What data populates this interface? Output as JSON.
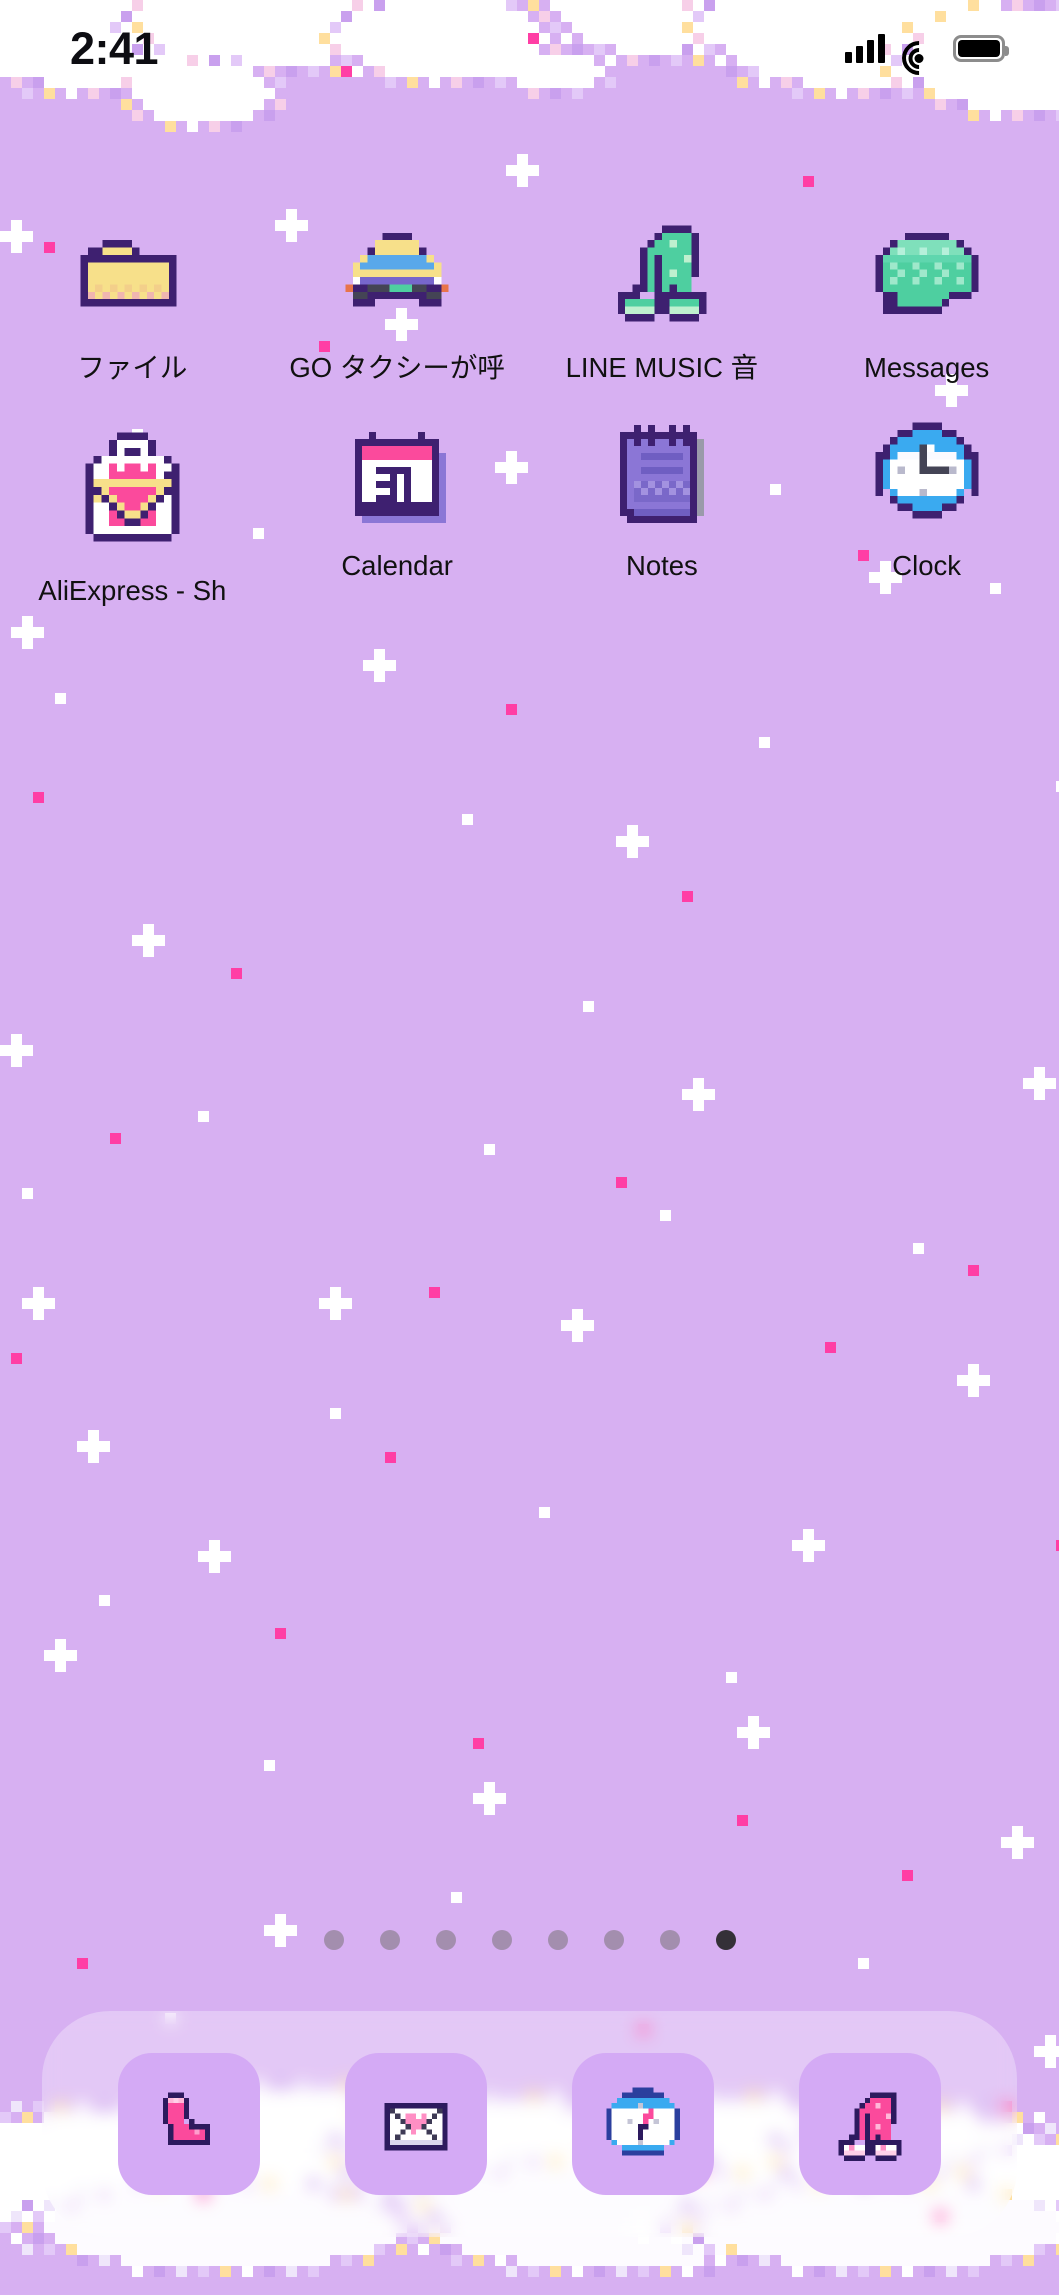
{
  "status_bar": {
    "time": "2:41",
    "cellular_icon": "signal-bars-icon",
    "wifi_icon": "wifi-icon",
    "battery_icon": "battery-full-icon"
  },
  "wallpaper": {
    "theme": "pixel-art-pastel-sky",
    "background_color": "#d7b0f2",
    "cloud_color": "#ffffff",
    "sparkle_color": "#ffffff",
    "accent_pink": "#ff3ea5",
    "accent_yellow": "#ffdf9e"
  },
  "home_screen": {
    "rows": [
      {
        "apps": [
          {
            "label": "ファイル",
            "icon": "folder-icon",
            "colors": {
              "body": "#f7e08a",
              "outline": "#3e2070",
              "accent": "#f0b6b0"
            }
          },
          {
            "label": "GO タクシーが呼",
            "icon": "taxi-icon",
            "colors": {
              "body": "#f7e08a",
              "outline": "#3e2070",
              "accent": "#59a8ea"
            }
          },
          {
            "label": "LINE MUSIC 音",
            "icon": "music-note-icon",
            "colors": {
              "body": "#4ecfa0",
              "outline": "#3e2070",
              "accent": "#bff0cf"
            }
          },
          {
            "label": "Messages",
            "icon": "speech-bubble-icon",
            "colors": {
              "body": "#4ecfa0",
              "outline": "#3e2070",
              "accent": "#9fe8cb"
            }
          }
        ]
      },
      {
        "apps": [
          {
            "label": "AliExpress - Sh",
            "icon": "shopping-bag-icon",
            "colors": {
              "body": "#fb4a9c",
              "outline": "#3e2070",
              "accent": "#f7e08a"
            }
          },
          {
            "label": "Calendar",
            "icon": "calendar-icon",
            "day": "31",
            "colors": {
              "body": "#ffffff",
              "outline": "#3e2070",
              "accent": "#fb4a9c"
            }
          },
          {
            "label": "Notes",
            "icon": "notepad-icon",
            "colors": {
              "body": "#8b76d6",
              "outline": "#3e2070",
              "accent": "#6f5ec2"
            }
          },
          {
            "label": "Clock",
            "icon": "clock-icon",
            "colors": {
              "body": "#ffffff",
              "outline": "#3e2070",
              "accent": "#3aaaf0"
            }
          }
        ]
      }
    ]
  },
  "page_indicator": {
    "total_pages": 8,
    "active_page": 8,
    "dot_color": "#5a6050",
    "active_dot_color": "#1e1e1e"
  },
  "dock": {
    "background": "rgba(255,255,255,0.30)",
    "tile_color": "#d4aaf5",
    "apps": [
      {
        "name": "Phone",
        "icon": "phone-handset-icon",
        "colors": {
          "body": "#fb4a9c",
          "outline": "#2d1a5e"
        }
      },
      {
        "name": "Mail",
        "icon": "envelope-heart-icon",
        "colors": {
          "body": "#ffffff",
          "outline": "#2d1a5e",
          "accent": "#ff8fc4"
        }
      },
      {
        "name": "Safari",
        "icon": "compass-icon",
        "colors": {
          "body": "#ffffff",
          "outline": "#2b3f9e",
          "accent": "#3aaaf0"
        }
      },
      {
        "name": "Music",
        "icon": "music-note-icon",
        "colors": {
          "body": "#fb4a9c",
          "outline": "#2d1a5e"
        }
      }
    ]
  }
}
